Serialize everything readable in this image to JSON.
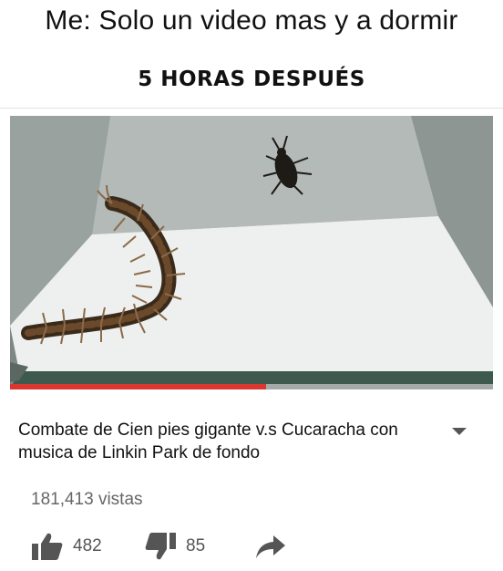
{
  "meme": {
    "top_text": "Me: Solo un video mas y a dormir",
    "sub_text": "5 HORAS DESPUÉS"
  },
  "video": {
    "title": "Combate de Cien pies gigante v.s Cucaracha con musica de Linkin Park de fondo",
    "views": "181,413 vistas",
    "likes": "482",
    "dislikes": "85",
    "progress_fraction": 0.53
  },
  "icons": {
    "expand": "chevron-down-icon",
    "like": "thumbs-up-icon",
    "dislike": "thumbs-down-icon",
    "share": "share-arrow-icon"
  },
  "colors": {
    "progress": "#d9372f",
    "text": "#111111",
    "muted": "#666666"
  }
}
